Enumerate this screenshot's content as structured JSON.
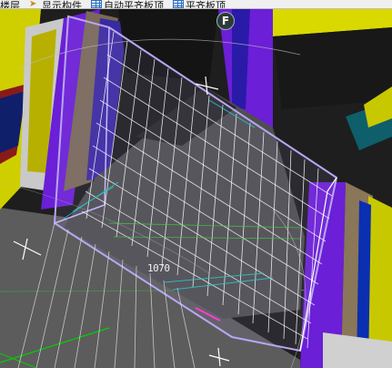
{
  "toolbar": {
    "items": [
      {
        "label": "楼层",
        "icon": "none"
      },
      {
        "label": "显示构件",
        "icon": "arrow-icon"
      },
      {
        "label": "自动平齐板顶",
        "icon": "grid-icon"
      },
      {
        "label": "平齐板顶",
        "icon": "grid-icon"
      }
    ]
  },
  "viewport": {
    "viewcube_face": "F",
    "dimension_text": "1070"
  },
  "colors": {
    "purple": "#6b1fd6",
    "yellow": "#d8d400",
    "gray_slab": "#5a5a5a",
    "brown": "#7a5a3a",
    "blue": "#0a2fb0",
    "wire": "#ffffff",
    "cyan": "#27c9c9"
  }
}
